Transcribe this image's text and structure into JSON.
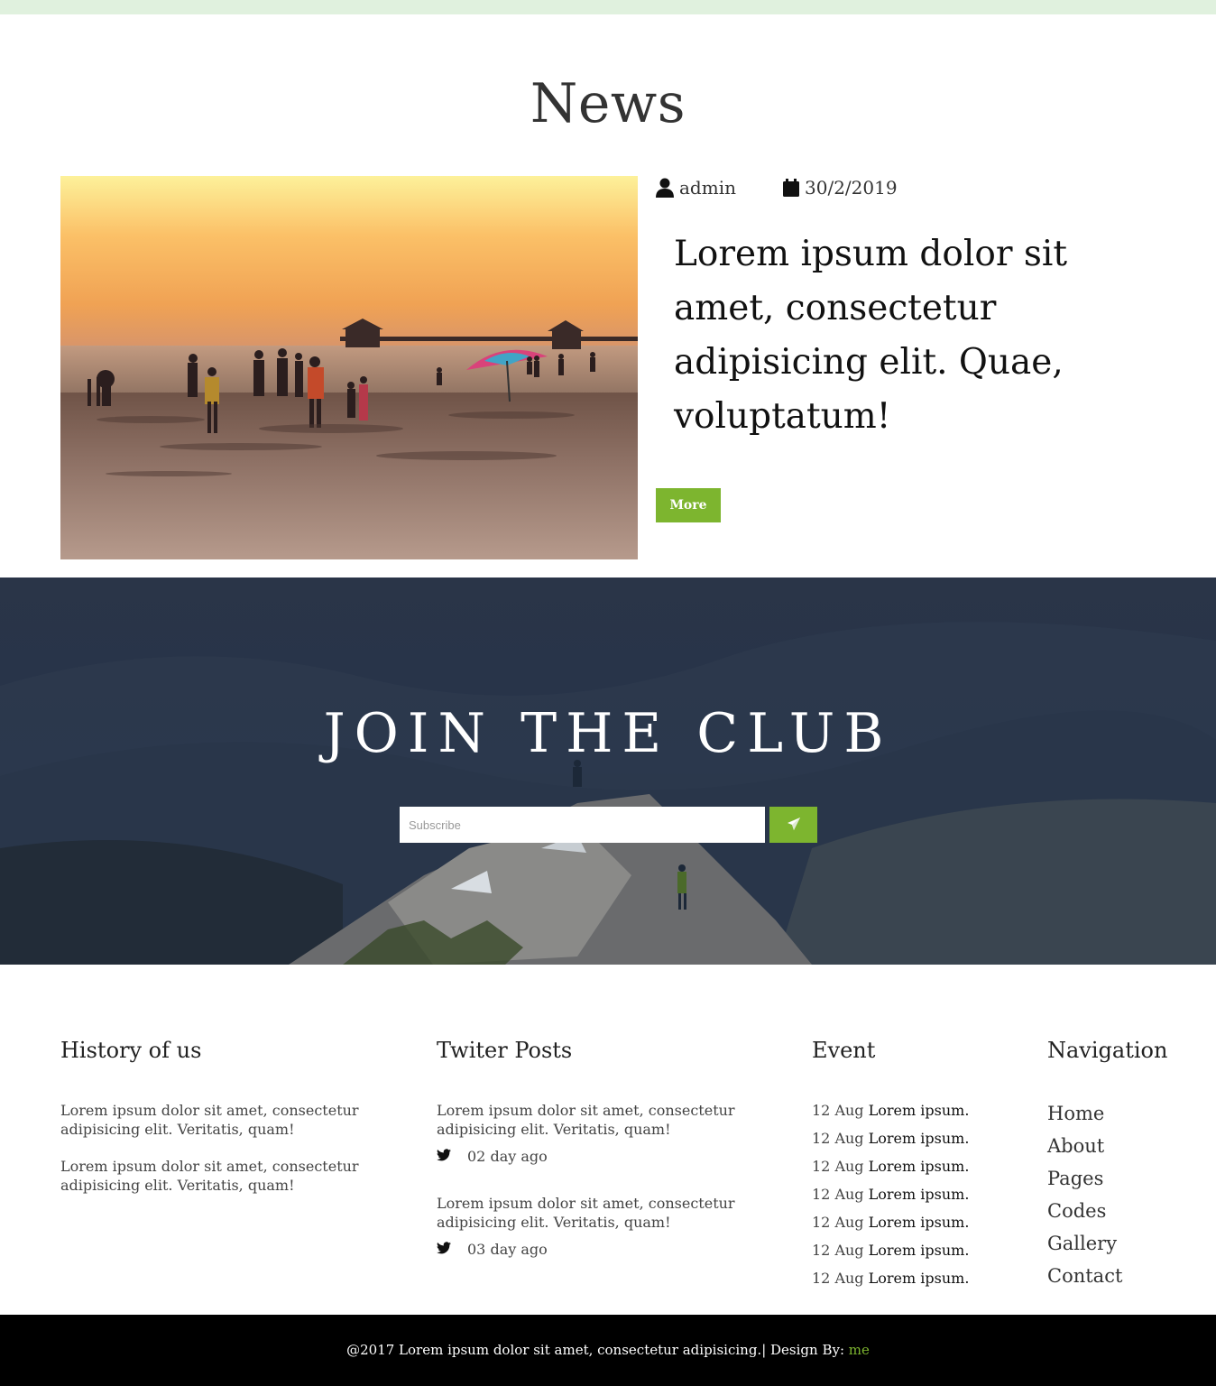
{
  "colors": {
    "accent": "#7db52f",
    "topbar": "#e0f1de",
    "footer_bg": "#000000"
  },
  "news": {
    "title": "News",
    "author": "admin",
    "date": "30/2/2019",
    "headline": "Lorem ipsum dolor sit amet, consectetur adipisicing elit. Quae, voluptatum!",
    "more_label": "More"
  },
  "club": {
    "title": "JOIN THE CLUB",
    "placeholder": "Subscribe",
    "send_icon": "paper-plane-icon"
  },
  "footer_cols": {
    "history": {
      "title": "History of us",
      "paragraphs": [
        "Lorem ipsum dolor sit amet, consectetur adipisicing elit. Veritatis, quam!",
        "Lorem ipsum dolor sit amet, consectetur adipisicing elit. Veritatis, quam!"
      ]
    },
    "twitter": {
      "title": "Twiter Posts",
      "posts": [
        {
          "text": "Lorem ipsum dolor sit amet, consectetur adipisicing elit. Veritatis, quam!",
          "time": "02 day ago"
        },
        {
          "text": "Lorem ipsum dolor sit amet, consectetur adipisicing elit. Veritatis, quam!",
          "time": "03 day ago"
        }
      ]
    },
    "event": {
      "title": "Event",
      "items": [
        {
          "date": "12 Aug",
          "text": "Lorem ipsum."
        },
        {
          "date": "12 Aug",
          "text": "Lorem ipsum."
        },
        {
          "date": "12 Aug",
          "text": "Lorem ipsum."
        },
        {
          "date": "12 Aug",
          "text": "Lorem ipsum."
        },
        {
          "date": "12 Aug",
          "text": "Lorem ipsum."
        },
        {
          "date": "12 Aug",
          "text": "Lorem ipsum."
        },
        {
          "date": "12 Aug",
          "text": "Lorem ipsum."
        }
      ]
    },
    "navigation": {
      "title": "Navigation",
      "links": [
        "Home",
        "About",
        "Pages",
        "Codes",
        "Gallery",
        "Contact"
      ]
    }
  },
  "footer": {
    "copyright": "@2017 Lorem ipsum dolor sit amet, consectetur adipisicing.| Design By: ",
    "designer": "me"
  }
}
